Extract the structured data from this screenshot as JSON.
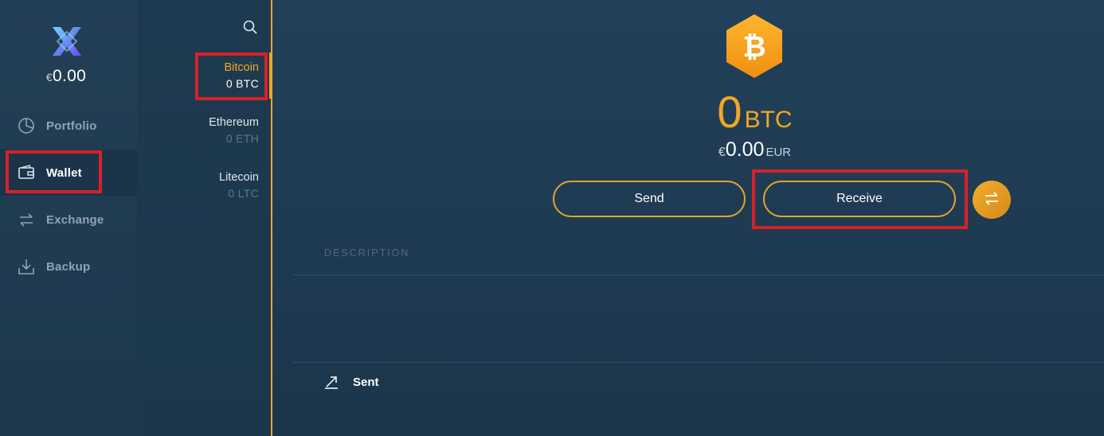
{
  "app": {
    "balance_symbol": "€",
    "balance_value": "0.00"
  },
  "nav": {
    "items": [
      {
        "label": "Portfolio",
        "icon": "pie-chart-icon"
      },
      {
        "label": "Wallet",
        "icon": "wallet-icon"
      },
      {
        "label": "Exchange",
        "icon": "exchange-arrows-icon"
      },
      {
        "label": "Backup",
        "icon": "download-icon"
      }
    ],
    "active": "Wallet"
  },
  "assets": {
    "items": [
      {
        "name": "Bitcoin",
        "amount": "0 BTC"
      },
      {
        "name": "Ethereum",
        "amount": "0 ETH"
      },
      {
        "name": "Litecoin",
        "amount": "0 LTC"
      }
    ],
    "active": "Bitcoin"
  },
  "main": {
    "coin_icon": "bitcoin-icon",
    "amount_value": "0",
    "amount_unit": "BTC",
    "fiat_symbol": "€",
    "fiat_value": "0.00",
    "fiat_unit": "EUR",
    "send_label": "Send",
    "receive_label": "Receive",
    "description_header": "DESCRIPTION",
    "sent_label": "Sent"
  },
  "colors": {
    "accent": "#f0a822",
    "background": "#1f3b52",
    "highlight": "#d6212b"
  }
}
